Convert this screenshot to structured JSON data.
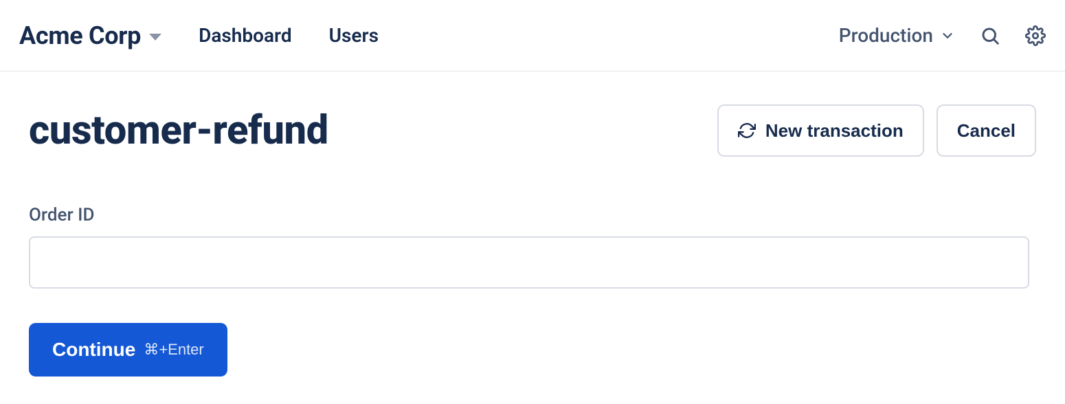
{
  "topnav": {
    "org_name": "Acme Corp",
    "links": {
      "dashboard": "Dashboard",
      "users": "Users"
    },
    "environment": "Production"
  },
  "page": {
    "title": "customer-refund"
  },
  "actions": {
    "new_transaction": "New transaction",
    "cancel": "Cancel"
  },
  "form": {
    "order_id_label": "Order ID",
    "order_id_value": ""
  },
  "submit": {
    "label": "Continue",
    "shortcut": "⌘+Enter"
  }
}
